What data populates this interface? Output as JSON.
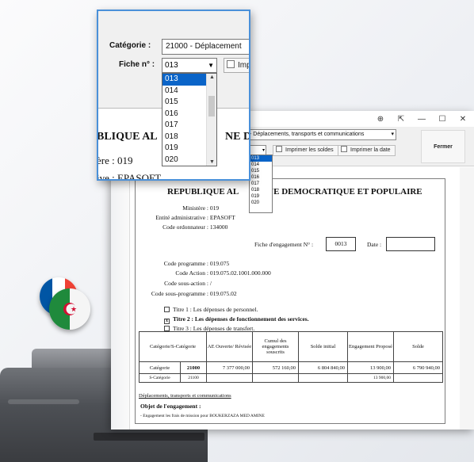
{
  "window": {
    "controls": [
      "⊕",
      "⇱",
      "—",
      "☐",
      "✕"
    ]
  },
  "toolbar": {
    "categorie_value": "- Déplacements, transports et communications",
    "chk_soldes": "Imprimer les soldes",
    "chk_date": "Imprimer la date",
    "fermer": "Fermer"
  },
  "small_dropdown": [
    "013",
    "014",
    "015",
    "016",
    "017",
    "018",
    "019",
    "020"
  ],
  "zoom": {
    "categorie_label": "Catégorie :",
    "categorie_value": "21000 - Déplacement",
    "fiche_label": "Fiche n° :",
    "fiche_value": "013",
    "chk_label": "Imp",
    "options": [
      "013",
      "014",
      "015",
      "016",
      "017",
      "018",
      "019",
      "020"
    ],
    "doc_title": "BLIQUE AL",
    "doc_title_right": "NE D",
    "line1": "ère :  019",
    "line2": "ive :  EPASOFT"
  },
  "document": {
    "title_left": "REPUBLIQUE AL",
    "title_right": "NE DEMOCRATIQUE ET POPULAIRE",
    "ministere_label": "Ministère :",
    "ministere_value": "019",
    "entite_label": "Entité administrative :",
    "entite_value": "EPASOFT",
    "ordonnateur_label": "Code ordonnateur :",
    "ordonnateur_value": "134000",
    "fiche_label": "Fiche d'engagement N° :",
    "fiche_value": "0013",
    "date_label": "Date :",
    "date_value": "",
    "programme_label": "Code programme :",
    "programme_value": "019.075",
    "action_label": "Code Action :",
    "action_value": "019.075.02.1001.000.000",
    "sousaction_label": "Code sous-action :",
    "sousaction_value": "/",
    "sousprog_label": "Code sous-programme :",
    "sousprog_value": "019.075.02",
    "titre1": "Titre 1 : Les dépenses de personnel.",
    "titre2": "Titre 2 : Les dépenses de fonctionnement des services.",
    "titre3": "Titre 3 : Les dépenses de transfert.",
    "titre2_checked": "x",
    "table": {
      "headers": [
        "Catégorie/S-Catégorie",
        "AE Ouverte/ Révisée",
        "Cumul des engagements souscrits",
        "Solde initial",
        "Engagement Proposé",
        "Solde"
      ],
      "row1": [
        "Catégorie",
        "21000",
        "7 377 000,00",
        "572 160,00",
        "6 804 840,00",
        "13 900,00",
        "6 790 940,00"
      ],
      "row2": [
        "S-Catégorie",
        "21100",
        "",
        "",
        "",
        "13 900,00",
        ""
      ]
    },
    "desc": "Déplacements, transports et communications",
    "objet_label": "Objet de l'engagement :",
    "objet_text": "- Engagement les frais de mission pour BOUKERZAZA MED AMINE"
  },
  "colors": {
    "selection": "#0a64c8",
    "zoom_border": "#4a90d9",
    "flag_green": "#1f8a3c",
    "flag_red": "#d21034",
    "fr_blue": "#0055a4",
    "fr_red": "#ef4135"
  }
}
